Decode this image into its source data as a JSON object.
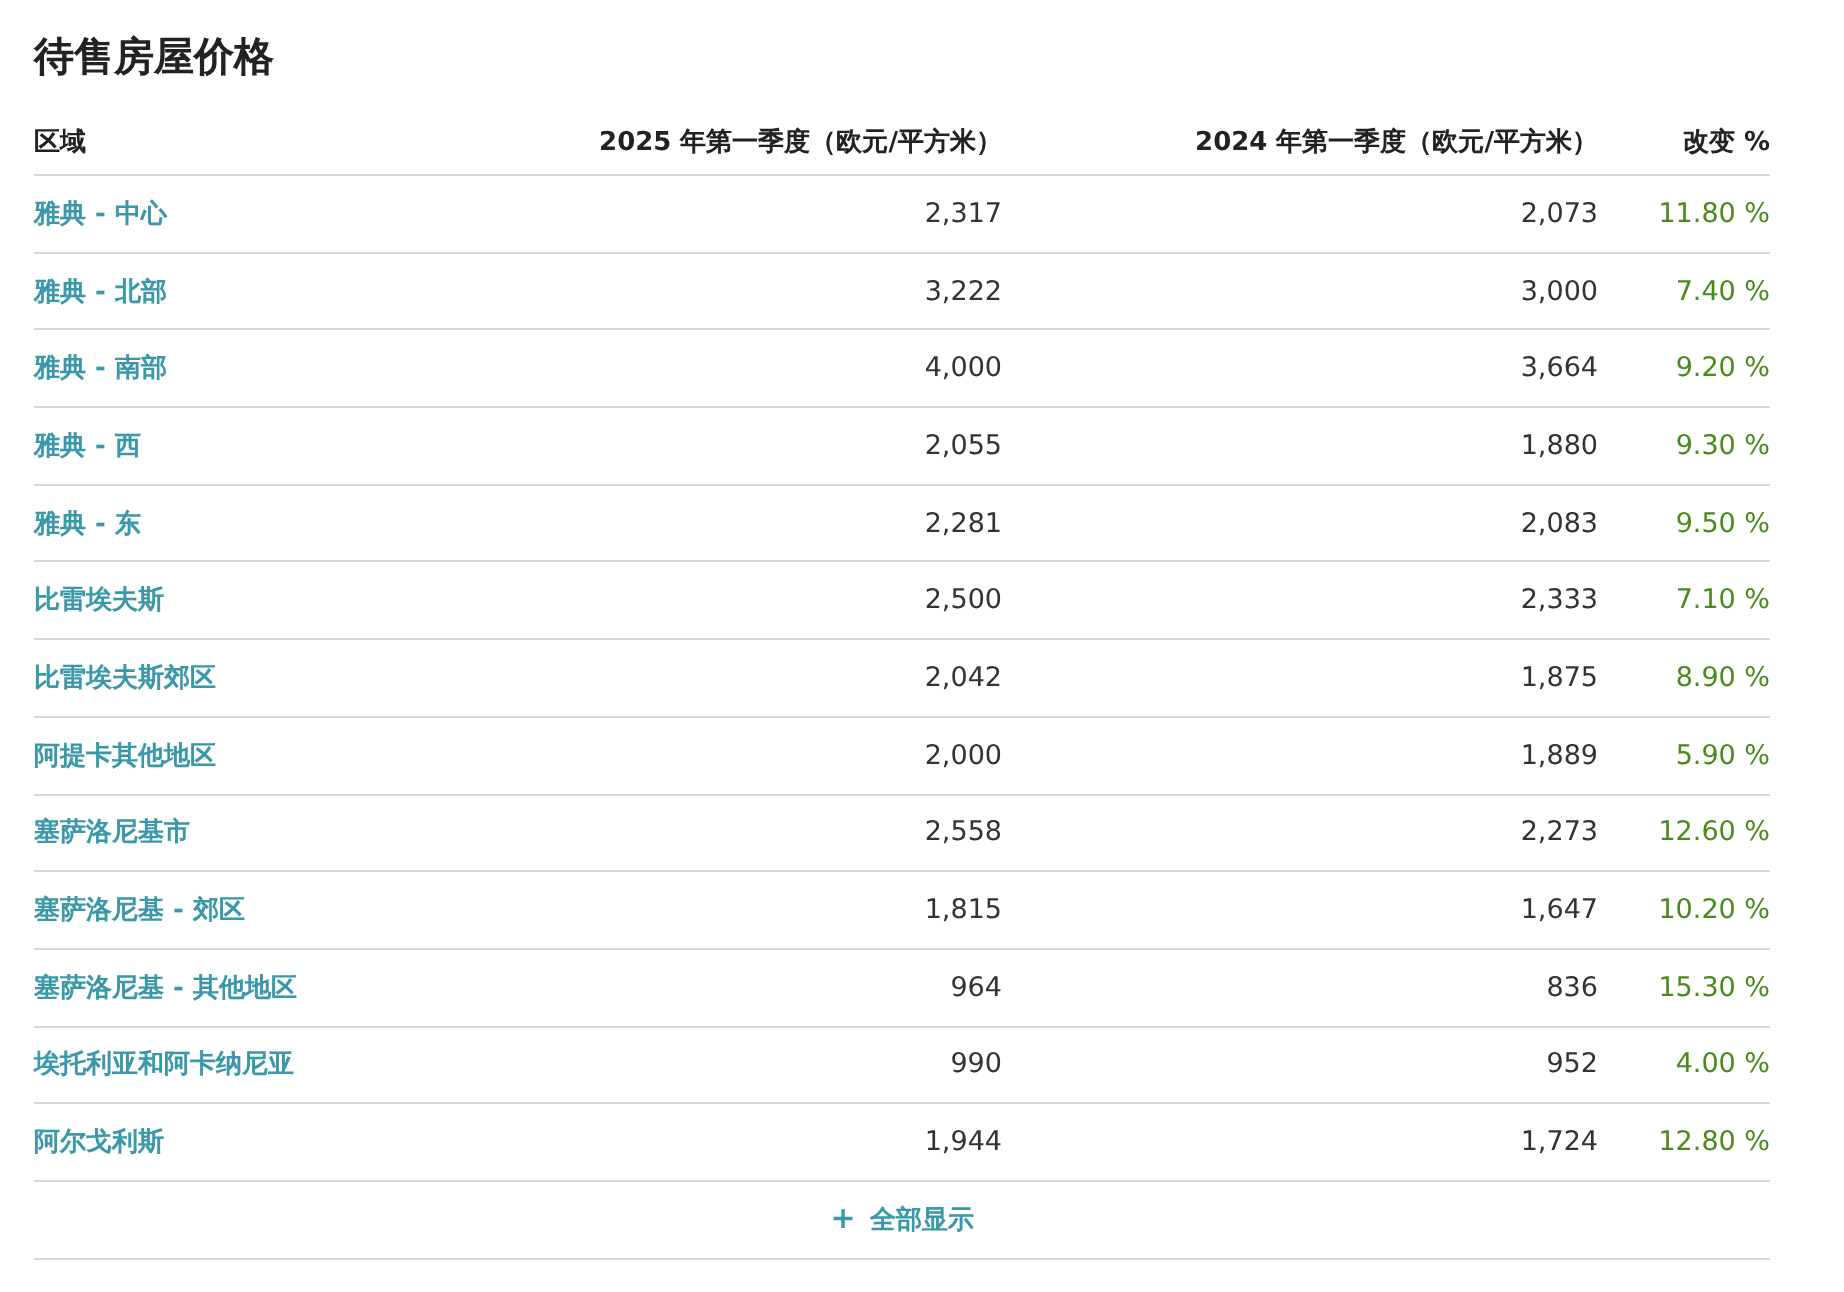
{
  "title": "待售房屋价格",
  "table": {
    "columns": [
      "区域",
      "2025 年第一季度（欧元/平方米）",
      "2024 年第一季度（欧元/平方米）",
      "改变 %"
    ],
    "rows": [
      {
        "region": "雅典 - 中心",
        "q1_2025": "2,317",
        "q1_2024": "2,073",
        "change": "11.80 %"
      },
      {
        "region": "雅典 - 北部",
        "q1_2025": "3,222",
        "q1_2024": "3,000",
        "change": "7.40 %"
      },
      {
        "region": "雅典 - 南部",
        "q1_2025": "4,000",
        "q1_2024": "3,664",
        "change": "9.20 %"
      },
      {
        "region": "雅典 - 西",
        "q1_2025": "2,055",
        "q1_2024": "1,880",
        "change": "9.30 %"
      },
      {
        "region": "雅典 - 东",
        "q1_2025": "2,281",
        "q1_2024": "2,083",
        "change": "9.50 %"
      },
      {
        "region": "比雷埃夫斯",
        "q1_2025": "2,500",
        "q1_2024": "2,333",
        "change": "7.10 %"
      },
      {
        "region": "比雷埃夫斯郊区",
        "q1_2025": "2,042",
        "q1_2024": "1,875",
        "change": "8.90 %"
      },
      {
        "region": "阿提卡其他地区",
        "q1_2025": "2,000",
        "q1_2024": "1,889",
        "change": "5.90 %"
      },
      {
        "region": "塞萨洛尼基市",
        "q1_2025": "2,558",
        "q1_2024": "2,273",
        "change": "12.60 %"
      },
      {
        "region": "塞萨洛尼基 - 郊区",
        "q1_2025": "1,815",
        "q1_2024": "1,647",
        "change": "10.20 %"
      },
      {
        "region": "塞萨洛尼基 - 其他地区",
        "q1_2025": "964",
        "q1_2024": "836",
        "change": "15.30 %"
      },
      {
        "region": "埃托利亚和阿卡纳尼亚",
        "q1_2025": "990",
        "q1_2024": "952",
        "change": "4.00 %"
      },
      {
        "region": "阿尔戈利斯",
        "q1_2025": "1,944",
        "q1_2024": "1,724",
        "change": "12.80 %"
      }
    ]
  },
  "show_all": {
    "icon": "+",
    "label": "全部显示"
  }
}
